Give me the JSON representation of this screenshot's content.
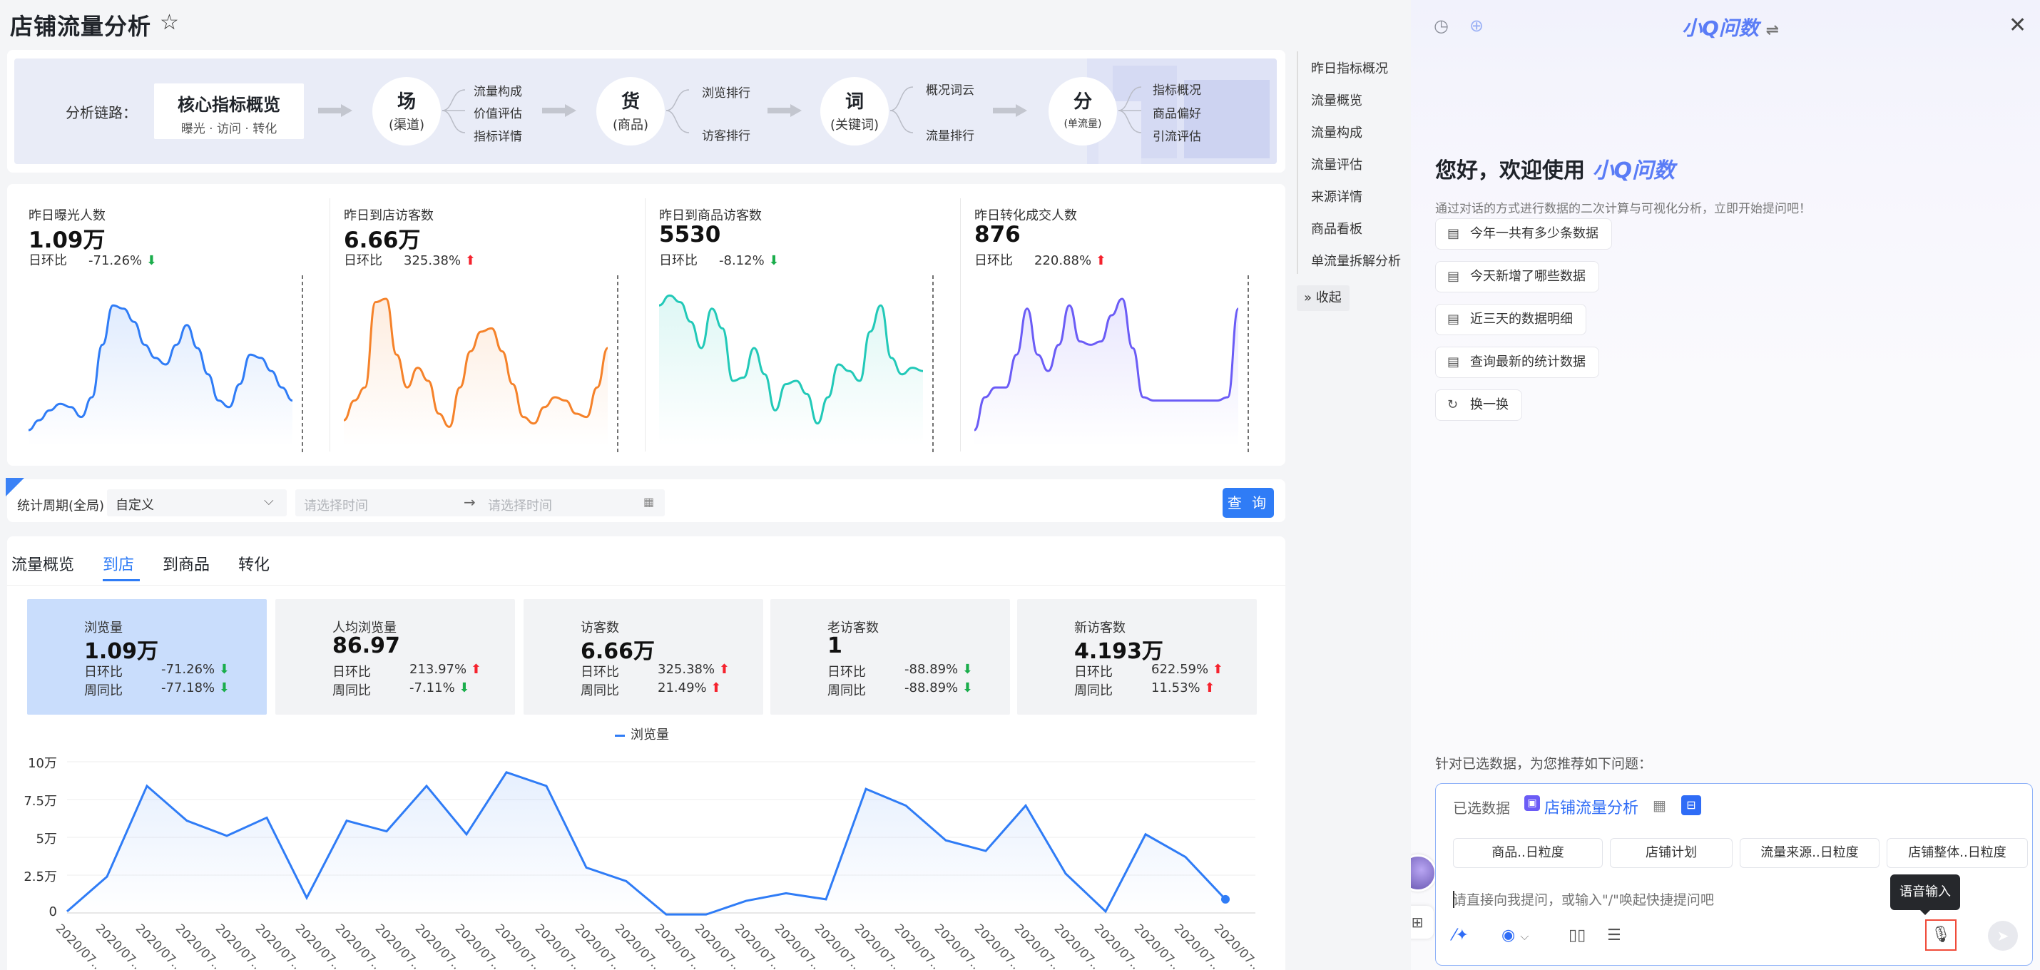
{
  "page": {
    "title": "店铺流量分析"
  },
  "chain": {
    "label": "分析链路：",
    "core": {
      "title": "核心指标概览",
      "sub": "曝光 · 访问 · 转化"
    },
    "nodes": [
      {
        "title": "场",
        "sub": "(渠道)",
        "items": [
          "流量构成",
          "价值评估",
          "指标详情"
        ]
      },
      {
        "title": "货",
        "sub": "(商品)",
        "items": [
          "浏览排行",
          "访客排行"
        ]
      },
      {
        "title": "词",
        "sub": "(关键词)",
        "items": [
          "概况词云",
          "流量排行"
        ]
      },
      {
        "title": "分",
        "sub": "(单流量)",
        "items": [
          "指标概况",
          "商品偏好",
          "引流评估"
        ]
      }
    ]
  },
  "kpis": [
    {
      "label": "昨日曝光人数",
      "value": "1.09万",
      "cmp_label": "日环比",
      "pct": "-71.26%",
      "dir": "down",
      "color": "#2f7cf6",
      "trend": [
        10,
        16,
        22,
        26,
        24,
        18,
        30,
        62,
        86,
        84,
        76,
        62,
        54,
        50,
        62,
        74,
        60,
        44,
        28,
        24,
        38,
        56,
        54,
        46,
        36,
        28
      ]
    },
    {
      "label": "昨日到店访客数",
      "value": "6.66万",
      "cmp_label": "日环比",
      "pct": "325.38%",
      "dir": "up",
      "color": "#f5822a",
      "trend": [
        16,
        28,
        36,
        88,
        90,
        56,
        36,
        48,
        40,
        20,
        12,
        36,
        58,
        70,
        72,
        58,
        38,
        18,
        14,
        24,
        30,
        28,
        20,
        18,
        36,
        60
      ]
    },
    {
      "label": "昨日到商品访客数",
      "value": "5530",
      "cmp_label": "日环比",
      "pct": "-8.12%",
      "dir": "down",
      "color": "#22c9b8",
      "trend": [
        86,
        92,
        88,
        76,
        60,
        84,
        72,
        40,
        42,
        60,
        44,
        22,
        38,
        40,
        32,
        14,
        30,
        50,
        46,
        40,
        70,
        86,
        54,
        44,
        48,
        46
      ]
    },
    {
      "label": "昨日转化成交人数",
      "value": "876",
      "cmp_label": "日环比",
      "pct": "220.88%",
      "dir": "up",
      "color": "#6b5cf6",
      "trend": [
        10,
        30,
        36,
        36,
        56,
        84,
        56,
        46,
        62,
        86,
        64,
        62,
        64,
        80,
        90,
        60,
        30,
        28,
        28,
        28,
        28,
        28,
        28,
        28,
        30,
        84
      ]
    }
  ],
  "filter": {
    "label": "统计周期(全局)",
    "period": "自定义",
    "start_placeholder": "请选择时间",
    "end_placeholder": "请选择时间",
    "query": "查 询"
  },
  "tabs": [
    "流量概览",
    "到店",
    "到商品",
    "转化"
  ],
  "metrics": [
    {
      "label": "浏览量",
      "value": "1.09万",
      "r1_label": "日环比",
      "r1": "-71.26%",
      "r1_dir": "down",
      "r2_label": "周同比",
      "r2": "-77.18%",
      "r2_dir": "down"
    },
    {
      "label": "人均浏览量",
      "value": "86.97",
      "r1_label": "日环比",
      "r1": "213.97%",
      "r1_dir": "up",
      "r2_label": "周同比",
      "r2": "-7.11%",
      "r2_dir": "down"
    },
    {
      "label": "访客数",
      "value": "6.66万",
      "r1_label": "日环比",
      "r1": "325.38%",
      "r1_dir": "up",
      "r2_label": "周同比",
      "r2": "21.49%",
      "r2_dir": "up"
    },
    {
      "label": "老访客数",
      "value": "1",
      "r1_label": "日环比",
      "r1": "-88.89%",
      "r1_dir": "down",
      "r2_label": "周同比",
      "r2": "-88.89%",
      "r2_dir": "down"
    },
    {
      "label": "新访客数",
      "value": "4.193万",
      "r1_label": "日环比",
      "r1": "622.59%",
      "r1_dir": "up",
      "r2_label": "周同比",
      "r2": "11.53%",
      "r2_dir": "up"
    }
  ],
  "chart_data": {
    "type": "line",
    "series": [
      {
        "name": "浏览量",
        "values": [
          1000,
          24000,
          84000,
          61000,
          51000,
          63000,
          10000,
          61000,
          54000,
          84000,
          52000,
          93000,
          84000,
          30000,
          21000,
          -1000,
          -1000,
          8000,
          13000,
          9000,
          82000,
          71000,
          48000,
          41000,
          71000,
          26000,
          1000,
          52000,
          37000,
          9000
        ]
      }
    ],
    "yticks": [
      "0",
      "2.5万",
      "5万",
      "7.5万",
      "10万"
    ],
    "ylim": [
      0,
      100000
    ],
    "xtick_label": "2020/07...",
    "grid": true,
    "legend": "top-center"
  },
  "nav": {
    "items": [
      "昨日指标概况",
      "流量概览",
      "流量构成",
      "流量评估",
      "来源详情",
      "商品看板",
      "单流量拆解分析"
    ],
    "collapse": "收起"
  },
  "assistant": {
    "title": "小Q问数",
    "greeting": "您好，欢迎使用",
    "greeting_brand": "小Q问数",
    "subtitle": "通过对话的方式进行数据的二次计算与可视化分析，立即开始提问吧！",
    "suggestions": [
      "今年一共有多少条数据",
      "今天新增了哪些数据",
      "近三天的数据明细",
      "查询最新的统计数据"
    ],
    "refresh": "换一换",
    "recommend": "针对已选数据，为您推荐如下问题：",
    "dataset_label": "已选数据",
    "dataset_name": "店铺流量分析",
    "chips": [
      "商品..日粒度",
      "店铺计划",
      "流量来源..日粒度",
      "店铺整体..日粒度"
    ],
    "input_placeholder": "请直接向我提问，或输入\"/\"唤起快捷提问吧",
    "voice_tooltip": "语音输入"
  }
}
